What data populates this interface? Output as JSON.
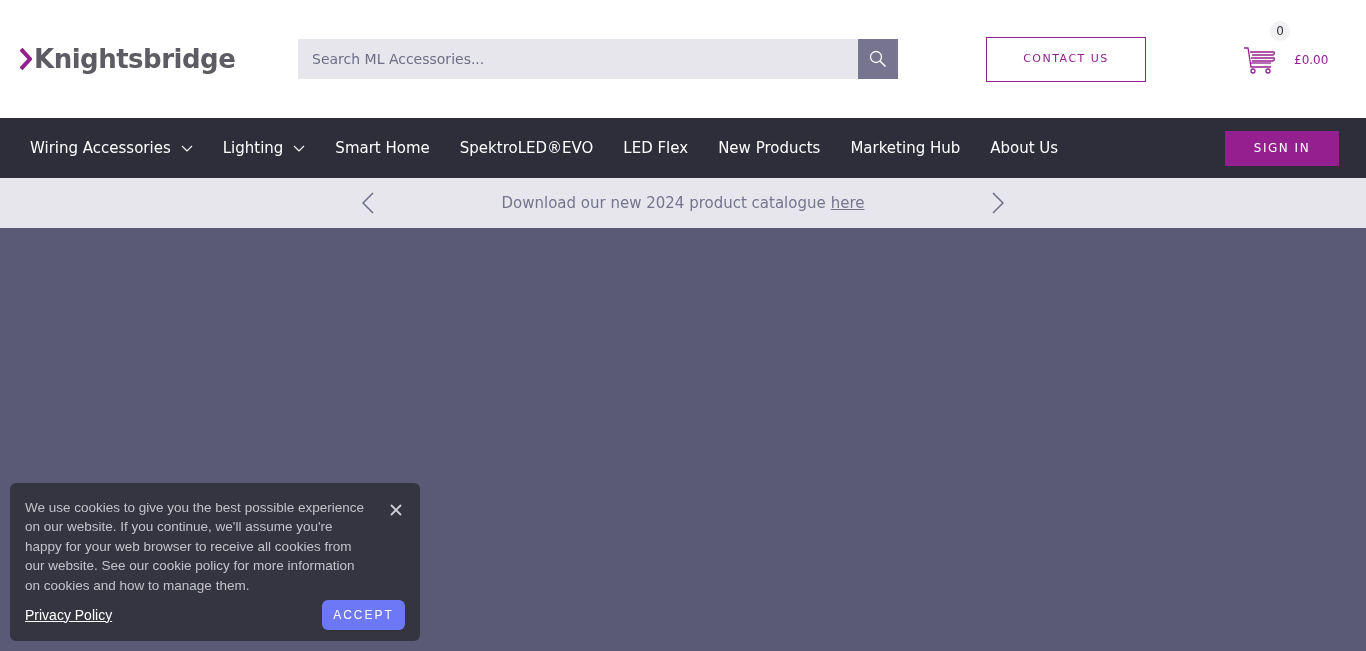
{
  "header": {
    "logo": "Knightsbridge",
    "search": {
      "placeholder": "Search ML Accessories..."
    },
    "contact_button": "CONTACT US",
    "cart": {
      "count": "0",
      "total": "£0.00"
    }
  },
  "nav": {
    "items": [
      {
        "label": "Wiring Accessories",
        "kind": "dropdown"
      },
      {
        "label": "Lighting",
        "kind": "dropdown"
      },
      {
        "label": "Smart Home",
        "kind": "link"
      },
      {
        "label": "SpektroLED®EVO",
        "kind": "link"
      },
      {
        "label": "LED Flex",
        "kind": "link"
      },
      {
        "label": "New Products",
        "kind": "link"
      },
      {
        "label": "Marketing Hub",
        "kind": "link"
      },
      {
        "label": "About Us",
        "kind": "link"
      }
    ],
    "sign_in": "SIGN IN"
  },
  "announcement": {
    "text": "Download our new 2024 product catalogue",
    "link": "here"
  },
  "cookie_banner": {
    "message": "We use cookies to give you the best possible experience on our website. If you continue, we'll assume you're happy for your web browser to receive all cookies from our website. See our cookie policy for more information on cookies and how to manage them.",
    "link": "Privacy Policy",
    "accept": "ACCEPT"
  }
}
